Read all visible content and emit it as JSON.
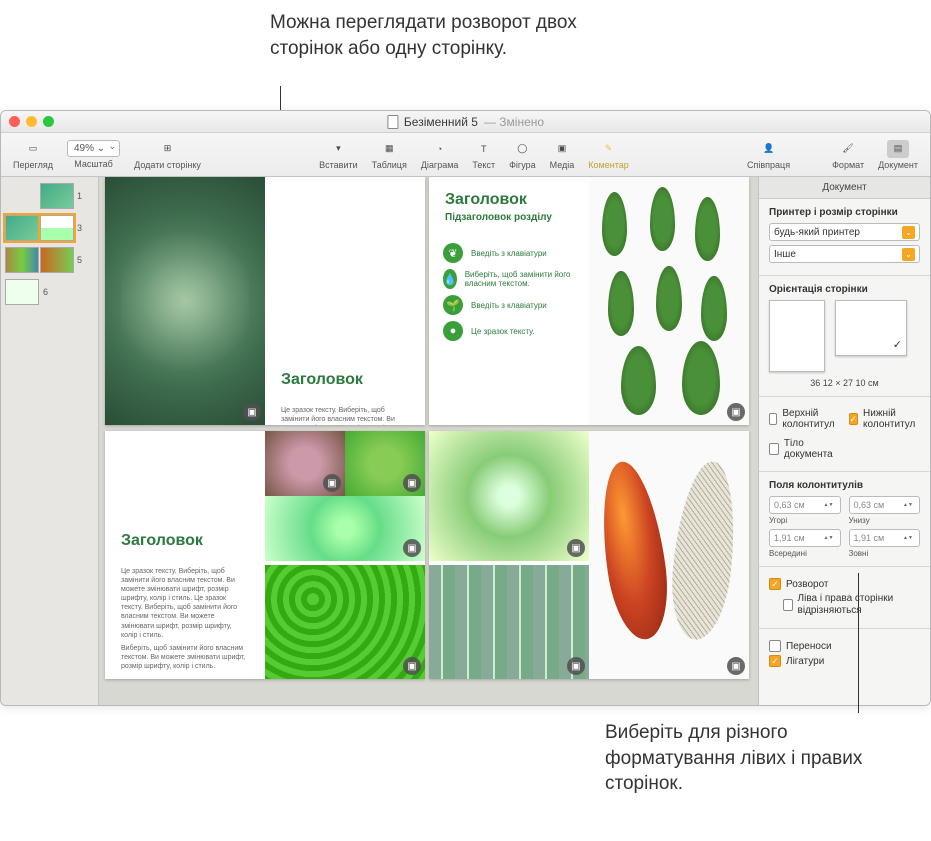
{
  "annotations": {
    "top": "Можна переглядати розворот двох сторінок або одну сторінку.",
    "bottom": "Виберіть для різного форматування лівих і правих сторінок."
  },
  "window": {
    "title": "Безіменний 5",
    "title_suffix": "— Змінено"
  },
  "toolbar": {
    "view": "Перегляд",
    "zoom_value": "49% ⌄",
    "zoom_label": "Масштаб",
    "add_page": "Додати сторінку",
    "insert": "Вставити",
    "table": "Таблиця",
    "chart": "Діаграма",
    "text": "Текст",
    "shape": "Фігура",
    "media": "Медіа",
    "comment": "Коментар",
    "collab": "Співпраця",
    "format": "Формат",
    "document": "Документ"
  },
  "thumbs": {
    "n1": "1",
    "n3": "3",
    "n5": "5",
    "n6": "6"
  },
  "page_content": {
    "heading": "Заголовок",
    "subheading": "Підзаголовок розділу",
    "bullet1": "Введіть з клавіатури",
    "bullet2": "Виберіть, щоб замінити його власним текстом.",
    "bullet3": "Введіть з клавіатури",
    "bullet4": "Це зразок тексту.",
    "lorem1": "Це зразок тексту. Виберіть, щоб замінити його власним текстом. Ви можете змінювати шрифт, розмір шрифту, колір і стиль.",
    "lorem2": "Це зразок тексту. Виберіть, щоб замінити його власним текстом. Ви можете змінювати шрифт, розмір шрифту, колір і стиль. Це зразок тексту. Виберіть, щоб замінити його власним текстом. Ви можете змінювати шрифт, розмір шрифту, колір і стиль.",
    "lorem3": "Виберіть, щоб замінити його власним текстом. Ви можете змінювати шрифт, розмір шрифту, колір і стиль."
  },
  "sidebar": {
    "tab": "Документ",
    "printer_label": "Принтер і розмір сторінки",
    "printer_value": "будь-який принтер",
    "size_value": "Інше",
    "orientation_label": "Орієнтація сторінки",
    "orientation_dim": "36 12 × 27 10 см",
    "header": "Верхній колонтитул",
    "footer": "Нижній колонтитул",
    "body": "Тіло документа",
    "margins_label": "Поля колонтитулів",
    "margin_top_val": "0,63 см",
    "margin_top_lbl": "Угорі",
    "margin_bottom_val": "0,63 см",
    "margin_bottom_lbl": "Унизу",
    "margin_in_val": "1,91 см",
    "margin_in_lbl": "Всередині",
    "margin_out_val": "1,91 см",
    "margin_out_lbl": "Зовні",
    "spread": "Розворот",
    "left_right_differ": "Ліва і права сторінки відрізняються",
    "hyphen": "Переноси",
    "ligatures": "Лігатури"
  }
}
